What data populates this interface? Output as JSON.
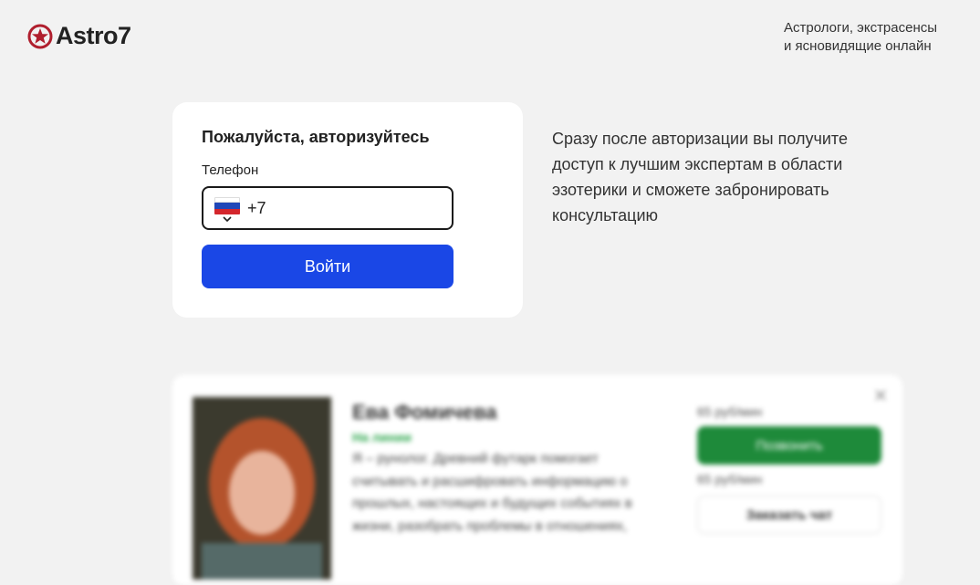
{
  "header": {
    "logo_text": "Astro7",
    "tagline_line1": "Астрологи, экстрасенсы",
    "tagline_line2": "и ясновидящие онлайн"
  },
  "auth": {
    "title": "Пожалуйста, авторизуйтесь",
    "phone_label": "Телефон",
    "phone_value": "+7",
    "country_flag": "russia-flag-icon",
    "submit_label": "Войти"
  },
  "info": {
    "text": "Сразу после авторизации вы получите доступ к лучшим экспертам в области эзотерики и сможете забронировать консультацию"
  },
  "expert": {
    "name": "Ева Фомичева",
    "status": "На линии",
    "description": "Я – рунолог. Древний футарк помогает считывать и расшифровать информацию о прошлых, настоящих и будущих событиях в жизни, разобрать проблемы в отношениях,",
    "call_price": "65 руб/мин",
    "call_label": "Позвонить",
    "chat_price": "65 руб/мин",
    "chat_label": "Заказать чат"
  },
  "colors": {
    "accent_blue": "#1a47e6",
    "call_green": "#1e8a3a",
    "logo_red": "#b01f2e",
    "background": "#f2f2f2"
  }
}
